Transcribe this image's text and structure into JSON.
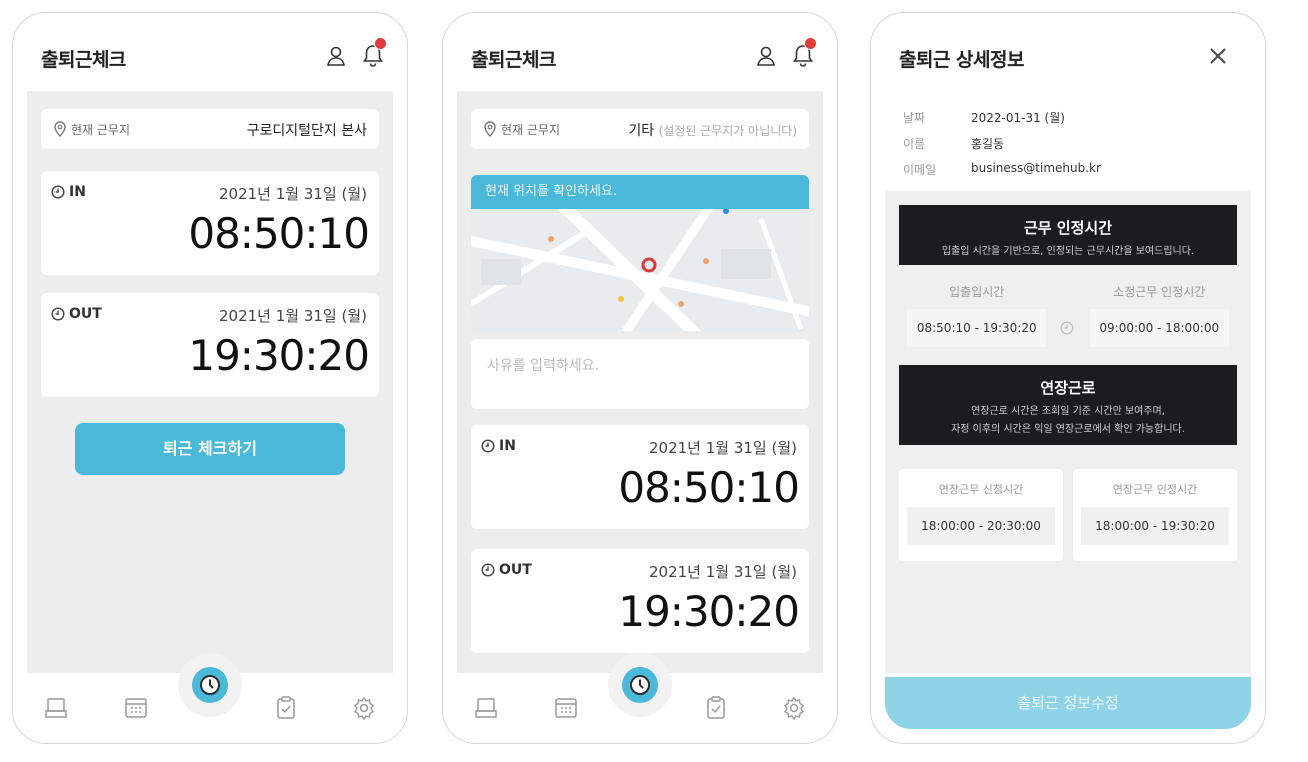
{
  "colors": {
    "accent": "#4ab8d8",
    "badge": "#e23b3b",
    "dark_block": "#1b1c1e",
    "accent_light": "#8fd3e8"
  },
  "icons": {
    "user": "user-icon",
    "bell": "bell-icon",
    "pin": "map-pin-icon",
    "clock": "clock-icon",
    "close": "close-icon"
  },
  "screen1": {
    "title": "출퇴근체크",
    "location": {
      "label": "현재 근무지",
      "value": "구로디지털단지 본사"
    },
    "in": {
      "kind": "IN",
      "date": "2021년 1월 31일 (월)",
      "time": "08:50:10"
    },
    "out": {
      "kind": "OUT",
      "date": "2021년 1월 31일 (월)",
      "time": "19:30:20"
    },
    "checkout_button": "퇴근 체크하기"
  },
  "screen2": {
    "title": "출퇴근체크",
    "location": {
      "label": "현재 근무지",
      "value": "기타",
      "sub": "(설정된 근무지가 아닙니다)"
    },
    "map_banner": "현재 위치를 확인하세요.",
    "reason_placeholder": "사유를 입력하세요.",
    "in": {
      "kind": "IN",
      "date": "2021년 1월 31일 (월)",
      "time": "08:50:10"
    },
    "out": {
      "kind": "OUT",
      "date": "2021년 1월 31일 (월)",
      "time": "19:30:20"
    }
  },
  "screen3": {
    "title": "출퇴근 상세정보",
    "info": [
      {
        "key": "날짜",
        "value": "2022-01-31 (월)"
      },
      {
        "key": "이름",
        "value": "홍길동"
      },
      {
        "key": "이메일",
        "value": "business@timehub.kr"
      }
    ],
    "recognized": {
      "title": "근무 인정시간",
      "desc": "입출입 시간을 기반으로, 인정되는 근무시간을 보여드립니다.",
      "left_label": "입출입시간",
      "left_value": "08:50:10 - 19:30:20",
      "right_label": "소정근무 인정시간",
      "right_value": "09:00:00 - 18:00:00"
    },
    "overtime": {
      "title": "연장근로",
      "desc1": "연장근로 시간은 조회일 기준 시간만 보여주며,",
      "desc2": "자정 이후의 시간은 익일 연장근로에서 확인 가능합니다.",
      "left_label": "연장근무 신청시간",
      "left_value": "18:00:00 - 20:30:00",
      "right_label": "연장근무 인정시간",
      "right_value": "18:00:00 - 19:30:20"
    },
    "edit_button": "출퇴근 정보수정"
  }
}
